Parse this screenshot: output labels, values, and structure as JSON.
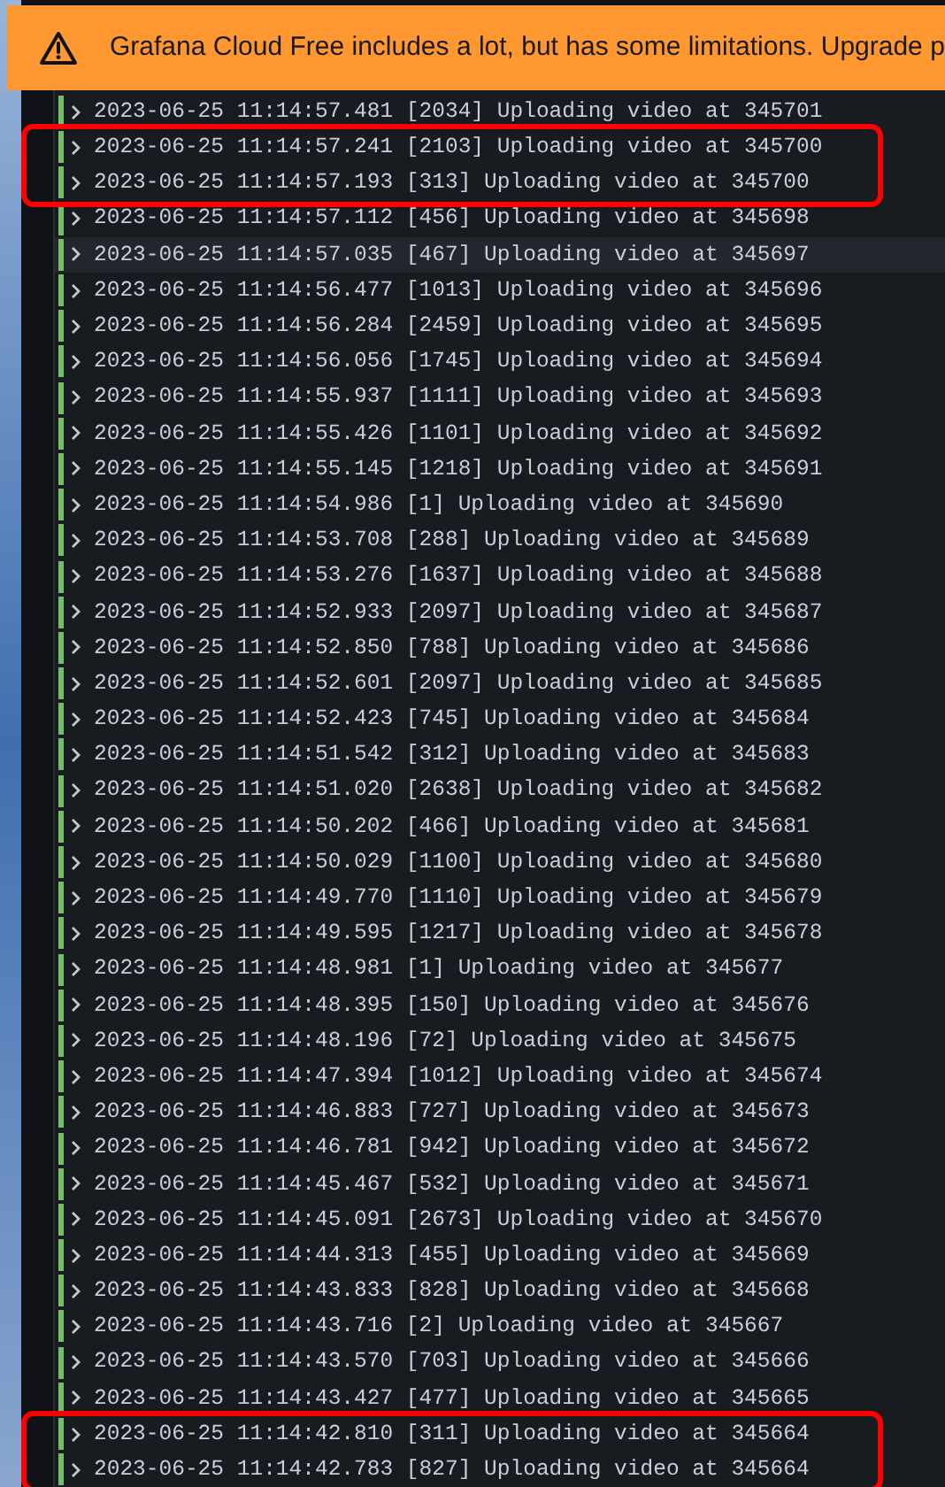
{
  "banner": {
    "text": "Grafana Cloud Free includes a lot, but has some limitations. Upgrade p"
  },
  "log_rows": [
    {
      "text": "2023-06-25 11:14:57.481 [2034] Uploading video at 345701",
      "marked": false,
      "hovered": false
    },
    {
      "text": "2023-06-25 11:14:57.241 [2103] Uploading video at 345700",
      "marked": true,
      "hovered": false
    },
    {
      "text": "2023-06-25 11:14:57.193 [313] Uploading video at 345700",
      "marked": true,
      "hovered": false
    },
    {
      "text": "2023-06-25 11:14:57.112 [456] Uploading video at 345698",
      "marked": false,
      "hovered": false
    },
    {
      "text": "2023-06-25 11:14:57.035 [467] Uploading video at 345697",
      "marked": false,
      "hovered": true
    },
    {
      "text": "2023-06-25 11:14:56.477 [1013] Uploading video at 345696",
      "marked": false,
      "hovered": false
    },
    {
      "text": "2023-06-25 11:14:56.284 [2459] Uploading video at 345695",
      "marked": false,
      "hovered": false
    },
    {
      "text": "2023-06-25 11:14:56.056 [1745] Uploading video at 345694",
      "marked": false,
      "hovered": false
    },
    {
      "text": "2023-06-25 11:14:55.937 [1111] Uploading video at 345693",
      "marked": false,
      "hovered": false
    },
    {
      "text": "2023-06-25 11:14:55.426 [1101] Uploading video at 345692",
      "marked": false,
      "hovered": false
    },
    {
      "text": "2023-06-25 11:14:55.145 [1218] Uploading video at 345691",
      "marked": false,
      "hovered": false
    },
    {
      "text": "2023-06-25 11:14:54.986 [1] Uploading video at 345690",
      "marked": false,
      "hovered": false
    },
    {
      "text": "2023-06-25 11:14:53.708 [288] Uploading video at 345689",
      "marked": false,
      "hovered": false
    },
    {
      "text": "2023-06-25 11:14:53.276 [1637] Uploading video at 345688",
      "marked": false,
      "hovered": false
    },
    {
      "text": "2023-06-25 11:14:52.933 [2097] Uploading video at 345687",
      "marked": false,
      "hovered": false
    },
    {
      "text": "2023-06-25 11:14:52.850 [788] Uploading video at 345686",
      "marked": false,
      "hovered": false
    },
    {
      "text": "2023-06-25 11:14:52.601 [2097] Uploading video at 345685",
      "marked": false,
      "hovered": false
    },
    {
      "text": "2023-06-25 11:14:52.423 [745] Uploading video at 345684",
      "marked": false,
      "hovered": false
    },
    {
      "text": "2023-06-25 11:14:51.542 [312] Uploading video at 345683",
      "marked": false,
      "hovered": false
    },
    {
      "text": "2023-06-25 11:14:51.020 [2638] Uploading video at 345682",
      "marked": false,
      "hovered": false
    },
    {
      "text": "2023-06-25 11:14:50.202 [466] Uploading video at 345681",
      "marked": false,
      "hovered": false
    },
    {
      "text": "2023-06-25 11:14:50.029 [1100] Uploading video at 345680",
      "marked": false,
      "hovered": false
    },
    {
      "text": "2023-06-25 11:14:49.770 [1110] Uploading video at 345679",
      "marked": false,
      "hovered": false
    },
    {
      "text": "2023-06-25 11:14:49.595 [1217] Uploading video at 345678",
      "marked": false,
      "hovered": false
    },
    {
      "text": "2023-06-25 11:14:48.981 [1] Uploading video at 345677",
      "marked": false,
      "hovered": false
    },
    {
      "text": "2023-06-25 11:14:48.395 [150] Uploading video at 345676",
      "marked": false,
      "hovered": false
    },
    {
      "text": "2023-06-25 11:14:48.196 [72] Uploading video at 345675",
      "marked": false,
      "hovered": false
    },
    {
      "text": "2023-06-25 11:14:47.394 [1012] Uploading video at 345674",
      "marked": false,
      "hovered": false
    },
    {
      "text": "2023-06-25 11:14:46.883 [727] Uploading video at 345673",
      "marked": false,
      "hovered": false
    },
    {
      "text": "2023-06-25 11:14:46.781 [942] Uploading video at 345672",
      "marked": false,
      "hovered": false
    },
    {
      "text": "2023-06-25 11:14:45.467 [532] Uploading video at 345671",
      "marked": false,
      "hovered": false
    },
    {
      "text": "2023-06-25 11:14:45.091 [2673] Uploading video at 345670",
      "marked": false,
      "hovered": false
    },
    {
      "text": "2023-06-25 11:14:44.313 [455] Uploading video at 345669",
      "marked": false,
      "hovered": false
    },
    {
      "text": "2023-06-25 11:14:43.833 [828] Uploading video at 345668",
      "marked": false,
      "hovered": false
    },
    {
      "text": "2023-06-25 11:14:43.716 [2] Uploading video at 345667",
      "marked": false,
      "hovered": false
    },
    {
      "text": "2023-06-25 11:14:43.570 [703] Uploading video at 345666",
      "marked": false,
      "hovered": false
    },
    {
      "text": "2023-06-25 11:14:43.427 [477] Uploading video at 345665",
      "marked": false,
      "hovered": false
    },
    {
      "text": "2023-06-25 11:14:42.810 [311] Uploading video at 345664",
      "marked": true,
      "hovered": false
    },
    {
      "text": "2023-06-25 11:14:42.783 [827] Uploading video at 345664",
      "marked": true,
      "hovered": false
    }
  ]
}
